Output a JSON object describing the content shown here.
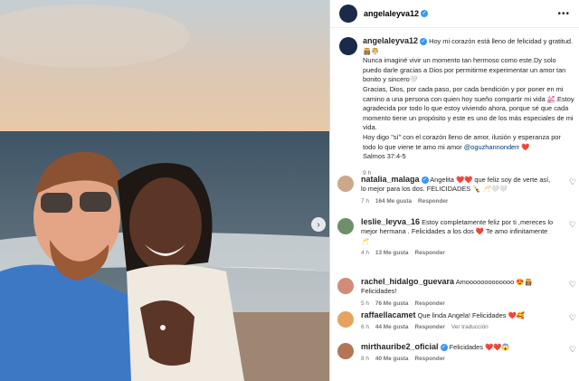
{
  "post": {
    "username": "angelaleyva12",
    "caption_user": "angelaleyva12",
    "caption_lines": [
      "Hoy mi corazón está lleno de felicidad y gratitud. 👸🏽🤴🏻",
      "Nunca imaginé vivir un momento tan hermoso como este.Dy solo puedo darle gracias a Dios por permitirme experimentar un amor tan bonito y sincero🤍",
      "Gracias, Dios, por cada paso, por cada bendición y por poner en mi camino a una persona con quien hoy sueño compartir mi vida 💒.Estoy agradecida por todo lo que estoy viviendo ahora, porque sé que cada momento tiene un propósito y este es uno de los más especiales de mi vida.",
      "Hoy digo \"sí\" con el corazón lleno de amor, ilusión y esperanza por todo lo que viene te amo mi amor"
    ],
    "mention": "@oguzhannonderr",
    "heart": "❤️",
    "verse": "Salmos 37:4-5",
    "time": "9 h"
  },
  "comments": [
    {
      "user": "natalia_malaga",
      "text": "Angelita ❤️❤️ que feliz soy de verte así, lo mejor para los dos. FELICIDADES 🍾 🥂🤍🤍",
      "time": "7 h",
      "likes": "164 Me gusta",
      "reply": "Responder",
      "extra": "",
      "color": "#c9a98a"
    },
    {
      "user": "leslie_leyva_16",
      "text": "Estoy completamente feliz por ti ,mereces lo mejor hermana . Felicidades a los dos ❤️ Te amo infinitamente 🥂",
      "time": "4 h",
      "likes": "13 Me gusta",
      "reply": "Responder",
      "extra": "",
      "color": "#6f8f6a"
    },
    {
      "user": "rachel_hidalgo_guevara",
      "text": "Amooooooooooooo 😍👸🏽Felicidades!",
      "time": "5 h",
      "likes": "76 Me gusta",
      "reply": "Responder",
      "extra": "",
      "color": "#d18c77"
    },
    {
      "user": "raffaellacamet",
      "text": "Que linda Angela! Felicidades ❤️🥰",
      "time": "6 h",
      "likes": "44 Me gusta",
      "reply": "Responder",
      "extra": "Ver traducción",
      "color": "#e6a35f"
    },
    {
      "user": "mirthauribe2_oficial",
      "text": "Felicidades ❤️❤️😱",
      "time": "8 h",
      "likes": "40 Me gusta",
      "reply": "Responder",
      "extra": "",
      "color": "#b37555"
    }
  ],
  "icons": {
    "verified": "verified-badge-icon",
    "more": "more-options-icon",
    "like": "heart-outline-icon",
    "next": "chevron-right-icon"
  },
  "colors": {
    "accent": "#3897f0",
    "heart": "#ed1c3a",
    "link": "#00376b",
    "muted": "#737373"
  }
}
